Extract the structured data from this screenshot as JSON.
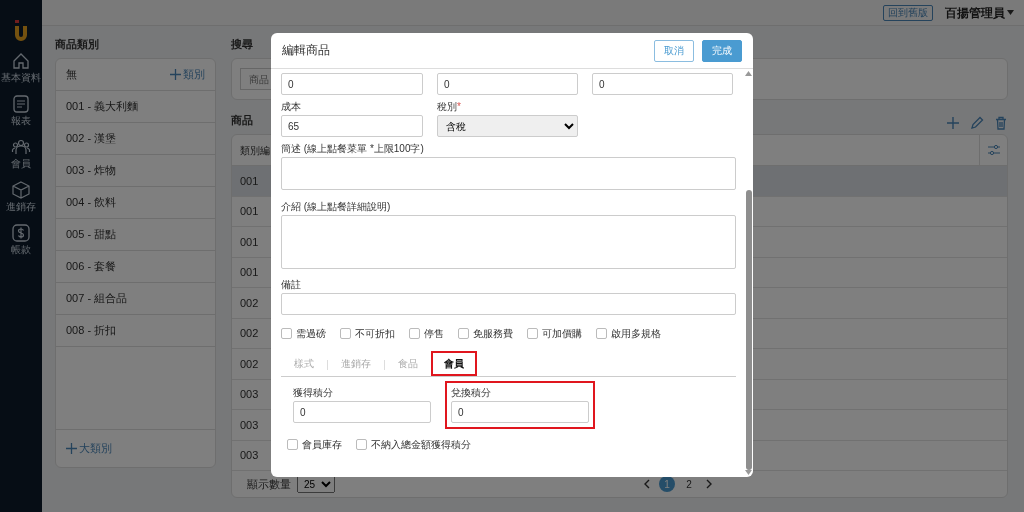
{
  "sidebar": {
    "items": [
      {
        "label": "基本資料",
        "kind": "home"
      },
      {
        "label": "報表",
        "kind": "report"
      },
      {
        "label": "會員",
        "kind": "members"
      },
      {
        "label": "進銷存",
        "kind": "inventory"
      },
      {
        "label": "帳款",
        "kind": "money"
      }
    ]
  },
  "top_bar": {
    "old_version_button": "回到舊版",
    "user_menu": "百揚管理員"
  },
  "categories": {
    "title": "商品類別",
    "header_label": "無",
    "add_category_button": "類別",
    "items": [
      {
        "label": "001 - 義大利麵"
      },
      {
        "label": "002 - 漢堡"
      },
      {
        "label": "003 - 炸物"
      },
      {
        "label": "004 - 飲料"
      },
      {
        "label": "005 - 甜點"
      },
      {
        "label": "006 - 套餐"
      },
      {
        "label": "007 - 組合品"
      },
      {
        "label": "008 - 折扣"
      }
    ],
    "add_major_category_button": "大類別"
  },
  "search": {
    "title": "搜尋",
    "placeholder": "商品"
  },
  "products": {
    "title": "商品",
    "columns": [
      "類別編"
    ],
    "rows": [
      {
        "code": "001",
        "selected": true
      },
      {
        "code": "001",
        "selected": false
      },
      {
        "code": "001",
        "selected": false
      },
      {
        "code": "001",
        "selected": false
      },
      {
        "code": "002",
        "selected": false
      },
      {
        "code": "002",
        "selected": false
      },
      {
        "code": "002",
        "selected": false
      },
      {
        "code": "003",
        "selected": false
      },
      {
        "code": "003",
        "selected": false
      },
      {
        "code": "003",
        "selected": false
      }
    ],
    "page_size_label": "顯示數量",
    "page_size": "25",
    "pages": [
      {
        "label": "1",
        "selected": true
      },
      {
        "label": "2",
        "selected": false
      }
    ]
  },
  "modal": {
    "title": "編輯商品",
    "cancel_button": "取消",
    "done_button": "完成",
    "top_inputs": [
      "0",
      "0",
      "0"
    ],
    "cost": {
      "label": "成本",
      "value": "65"
    },
    "tax": {
      "label": "稅別",
      "required_mark": "*",
      "value": "含稅"
    },
    "summary": {
      "label": "簡述 (線上點餐菜單 *上限100字)"
    },
    "intro": {
      "label": "介紹 (線上點餐詳細說明)"
    },
    "note": {
      "label": "備註"
    },
    "options": [
      {
        "label": "需過磅",
        "checked": false
      },
      {
        "label": "不可折扣",
        "checked": false
      },
      {
        "label": "停售",
        "checked": false
      },
      {
        "label": "免服務費",
        "checked": false
      },
      {
        "label": "可加價購",
        "checked": false
      },
      {
        "label": "啟用多規格",
        "checked": false
      }
    ],
    "tabs": [
      {
        "label": "樣式",
        "selected": false,
        "highlighted": false
      },
      {
        "label": "進銷存",
        "selected": false,
        "highlighted": false
      },
      {
        "label": "食品",
        "selected": false,
        "highlighted": false
      },
      {
        "label": "會員",
        "selected": true,
        "highlighted": true
      }
    ],
    "member_fields": [
      {
        "label": "獲得積分",
        "value": "0",
        "highlighted": false
      },
      {
        "label": "兌換積分",
        "value": "0",
        "highlighted": true
      }
    ],
    "member_options": [
      {
        "label": "會員庫存",
        "checked": false
      },
      {
        "label": "不納入總金額獲得積分",
        "checked": false
      }
    ]
  }
}
